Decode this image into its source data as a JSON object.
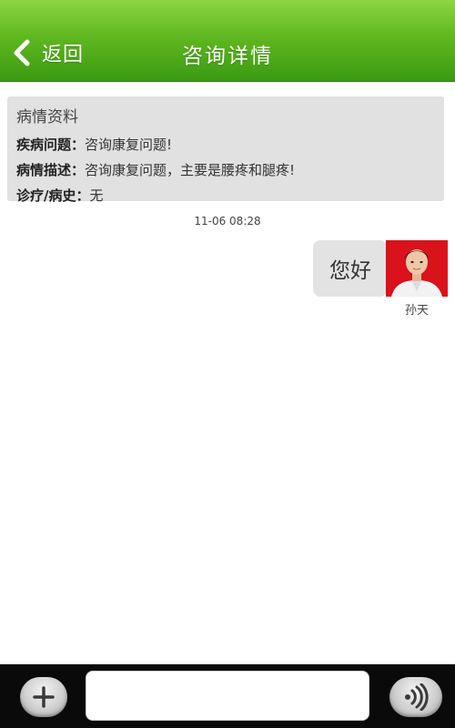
{
  "header": {
    "back_label": "返回",
    "title": "咨询详情",
    "back_icon": "chevron-left-icon"
  },
  "case_info": {
    "title": "病情资料",
    "rows": [
      {
        "key": "疾病问题",
        "value": "咨询康复问题!"
      },
      {
        "key": "病情描述",
        "value": "咨询康复问题，主要是腰疼和腿疼!"
      },
      {
        "key": "诊疗/病史",
        "value": "无"
      }
    ]
  },
  "conversation": {
    "timestamp": "11-06 08:28",
    "messages": [
      {
        "text": "您好",
        "sender": "孙天"
      }
    ]
  },
  "input_bar": {
    "plus_icon": "plus-icon",
    "voice_icon": "voice-icon",
    "message_value": ""
  },
  "colors": {
    "header_green": "#5fb81f",
    "card_bg": "#e1e1e1",
    "bubble_bg": "#e3e3e3",
    "bottom_bar": "#0a0a0a",
    "avatar_bg": "#d9121b"
  }
}
